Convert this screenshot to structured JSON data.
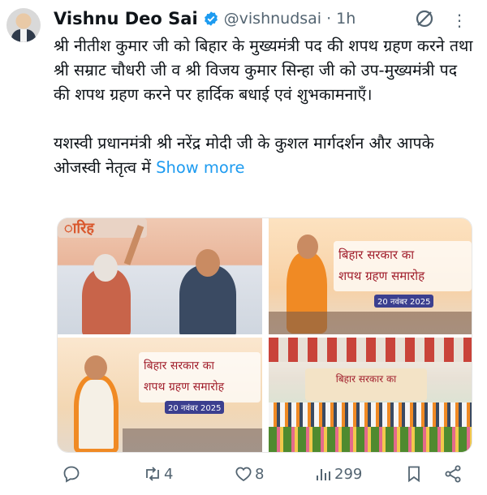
{
  "author": {
    "name": "Vishnu Deo Sai",
    "handle": "@vishnudsai",
    "separator": "·",
    "time": "1h"
  },
  "tweet": {
    "paragraph1": "श्री नीतीश कुमार जी को बिहार के मुख्यमंत्री पद की शपथ ग्रहण करने तथा श्री सम्राट चौधरी जी व श्री विजय कुमार सिन्हा जी को उप-मुख्यमंत्री पद की शपथ ग्रहण करने पर हार्दिक बधाई एवं शुभकामनाएँ।",
    "paragraph2": "यशस्वी प्रधानमंत्री श्री नरेंद्र मोदी जी के कुशल मार्गदर्शन और आपके ओजस्वी नेतृत्व में",
    "show_more": "Show more"
  },
  "media": {
    "photo1_banner": "ारिह",
    "photo2_banner1": "बिहार सरकार का",
    "photo2_banner2": "शपथ ग्रहण समारोह",
    "photo2_date": "20 नवंबर 2025",
    "photo3_banner1": "बिहार सरकार का",
    "photo3_banner2": "शपथ ग्रहण समारोह",
    "photo3_date": "20 नवंबर 2025",
    "photo4_banner": "बिहार सरकार का"
  },
  "actions": {
    "reply_count": "",
    "retweet_count": "4",
    "like_count": "8",
    "views_count": "299"
  },
  "colors": {
    "text": "#0f1419",
    "secondary": "#536471",
    "link": "#1d9bf0",
    "verified": "#1d9bf0"
  }
}
